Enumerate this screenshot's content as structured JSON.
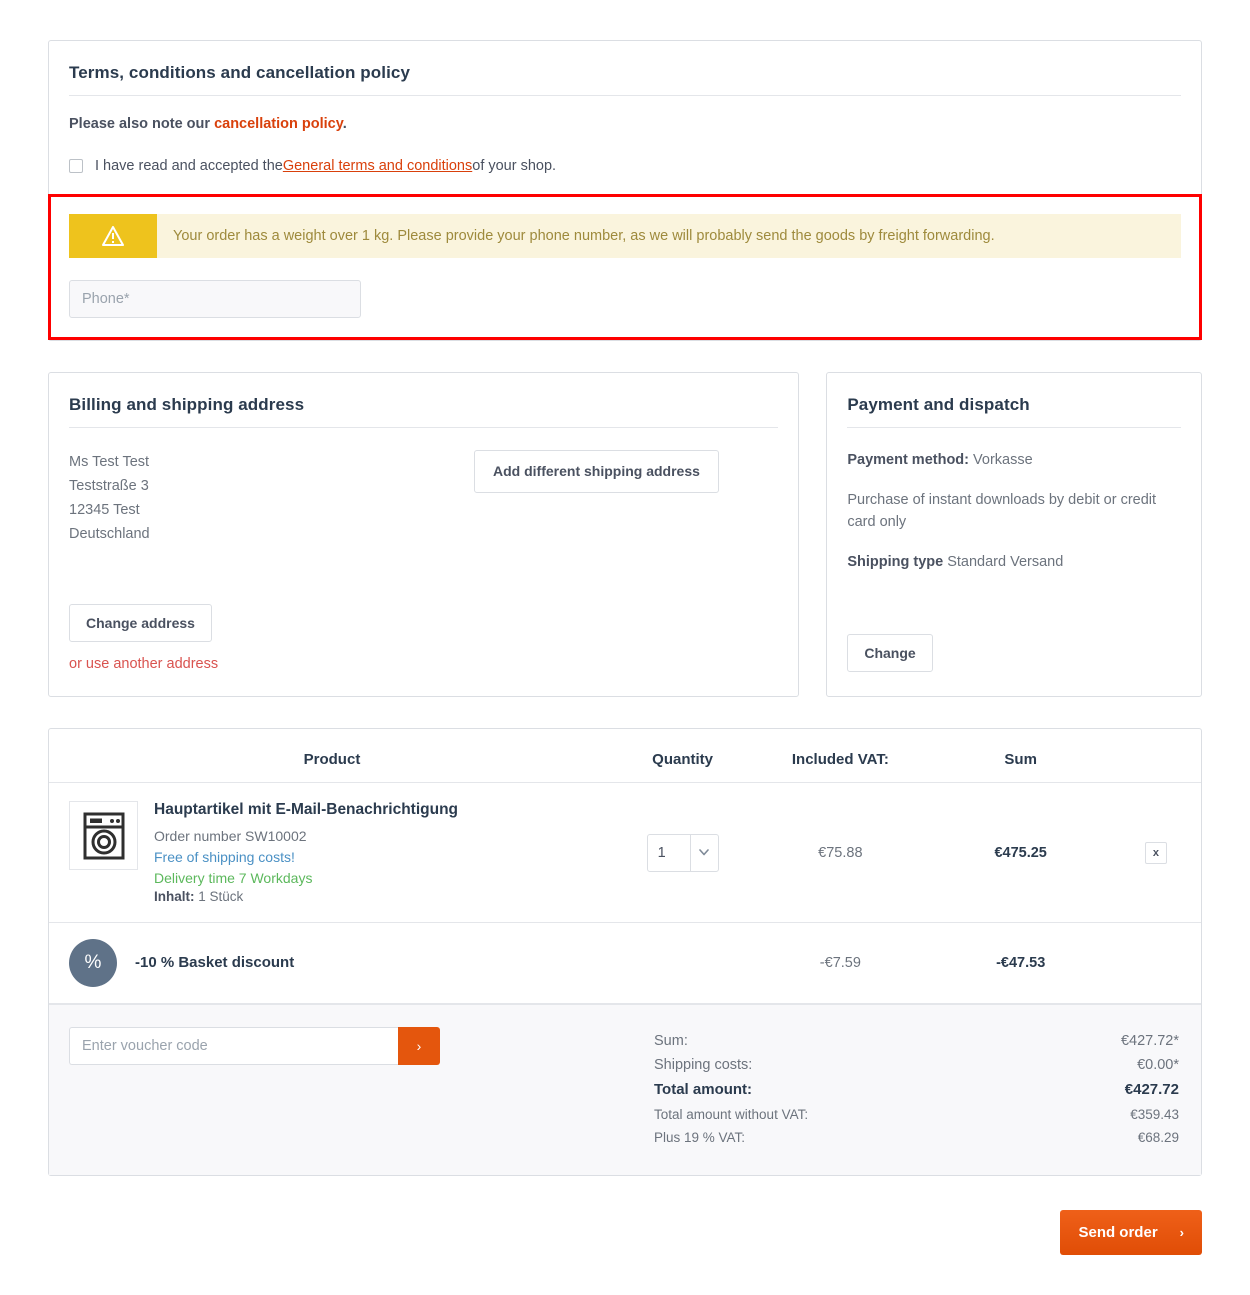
{
  "terms": {
    "title": "Terms, conditions and cancellation policy",
    "note_prefix": "Please also note our ",
    "note_link": "cancellation policy",
    "note_suffix": ".",
    "accept_prefix": "I have read and accepted the ",
    "accept_link": "General terms and conditions",
    "accept_suffix": " of your shop.",
    "alert_icon": "warning-triangle-icon",
    "alert_text": "Your order has a weight over 1 kg. Please provide your phone number, as we will probably send the goods by freight forwarding.",
    "phone_placeholder": "Phone*",
    "phone_value": ""
  },
  "address": {
    "title": "Billing and shipping address",
    "lines": [
      "Ms Test Test",
      "Teststraße 3",
      "12345 Test",
      "Deutschland"
    ],
    "different_shipping_button": "Add different shipping address",
    "change_button": "Change address",
    "another_address_link": "or use another address"
  },
  "payment": {
    "title": "Payment and dispatch",
    "method_label": "Payment method:",
    "method_value": "Vorkasse",
    "method_description": "Purchase of instant downloads by debit or credit card only",
    "shipping_label": "Shipping type",
    "shipping_value": "Standard Versand",
    "change_button": "Change"
  },
  "basket": {
    "columns": {
      "product": "Product",
      "quantity": "Quantity",
      "vat": "Included VAT:",
      "sum": "Sum"
    },
    "items": [
      {
        "image_icon": "washing-machine-icon",
        "name": "Hauptartikel mit E-Mail-Benachrichtigung",
        "order_number": "Order number SW10002",
        "free_shipping": "Free of shipping costs!",
        "delivery_time": "Delivery time 7 Workdays",
        "content_label": "Inhalt:",
        "content_value": "1 Stück",
        "quantity": "1",
        "vat": "€75.88",
        "sum": "€475.25",
        "delete_label": "x"
      }
    ],
    "discount": {
      "badge_icon": "percent-icon",
      "badge_glyph": "%",
      "label": "-10 % Basket discount",
      "vat": "-€7.59",
      "sum": "-€47.53"
    },
    "voucher_placeholder": "Enter voucher code",
    "voucher_value": "",
    "voucher_submit_glyph": "›",
    "totals": [
      {
        "label": "Sum:",
        "value": "€427.72*",
        "style": "normal"
      },
      {
        "label": "Shipping costs:",
        "value": "€0.00*",
        "style": "normal"
      },
      {
        "label": "Total amount:",
        "value": "€427.72",
        "style": "bold"
      },
      {
        "label": "Total amount without VAT:",
        "value": "€359.43",
        "style": "small"
      },
      {
        "label": "Plus 19 % VAT:",
        "value": "€68.29",
        "style": "small"
      }
    ]
  },
  "footer": {
    "send_order_label": "Send order",
    "send_order_chevron": "›"
  },
  "colors": {
    "accent_orange": "#e4560d",
    "link_red": "#d9400b",
    "alert_bg": "#faf4dd",
    "alert_icon_bg": "#eec31d",
    "highlight_border": "#fe0000",
    "heading": "#2b3b4e",
    "green": "#5cb85c",
    "blue": "#4a90c4",
    "discount_badge": "#5f7288"
  }
}
